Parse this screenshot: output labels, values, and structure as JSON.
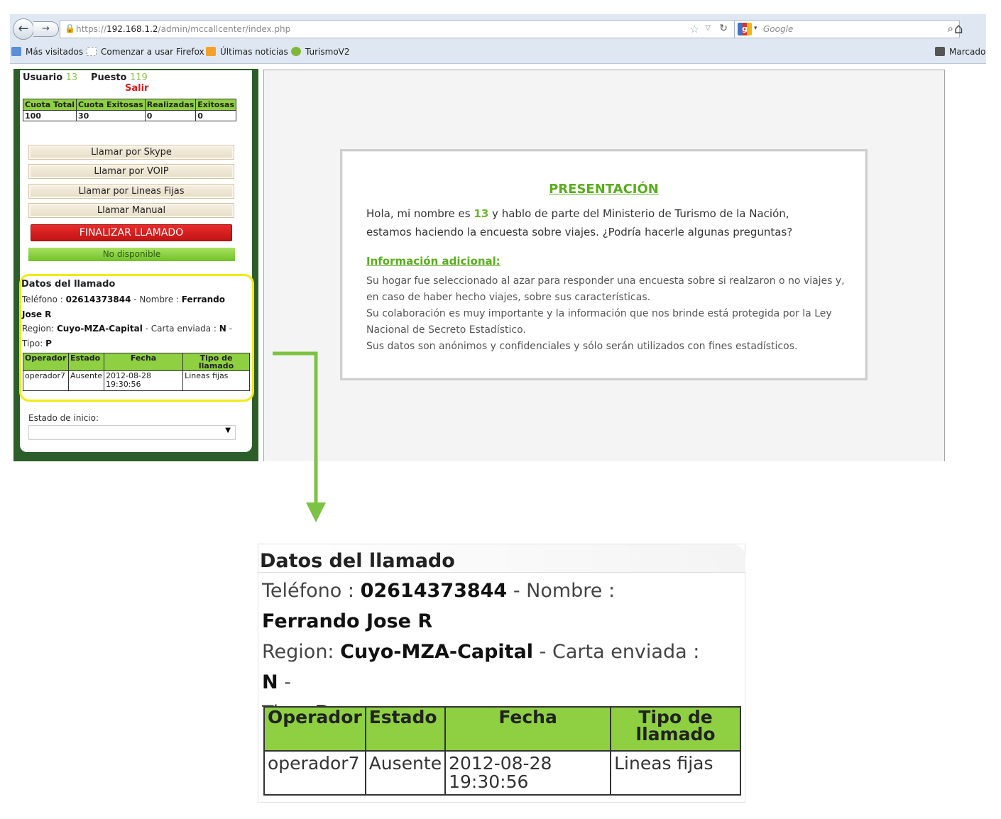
{
  "browser": {
    "url_prefix": "https://",
    "url_host": "192.168.1.2",
    "url_path": "/admin/mccallcenter/index.php",
    "search_placeholder": "Google",
    "bookmarks": [
      {
        "label": "Más visitados",
        "icon": "globe-icon"
      },
      {
        "label": "Comenzar a usar Firefox",
        "icon": "page-icon"
      },
      {
        "label": "Últimas noticias",
        "icon": "rss-icon"
      },
      {
        "label": "TurismoV2",
        "icon": "flag-icon"
      },
      {
        "label": "Marcado",
        "icon": "bookmarks-icon"
      }
    ]
  },
  "sidebar": {
    "usuario_label": "Usuario",
    "usuario_value": "13",
    "puesto_label": "Puesto",
    "puesto_value": "119",
    "salir": "Salir",
    "cuota_headers": [
      "Cuota Total",
      "Cuota Exitosas",
      "Realizadas",
      "Exitosas"
    ],
    "cuota_values": [
      "100",
      "30",
      "0",
      "0"
    ],
    "buttons": [
      "Llamar por Skype",
      "Llamar por VOIP",
      "Llamar por Lineas Fijas",
      "Llamar Manual"
    ],
    "finalizar": "FINALIZAR LLAMADO",
    "status": "No disponible",
    "estado_inicio_label": "Estado de inicio:",
    "estado_inicio_value": ""
  },
  "datos": {
    "title": "Datos del llamado",
    "telefono_label": "Teléfono :",
    "telefono": "02614373844",
    "nombre_label": "- Nombre :",
    "nombre": "Ferrando Jose R",
    "region_label": "Region:",
    "region": "Cuyo-MZA-Capital",
    "carta_label": "- Carta enviada :",
    "carta": "N",
    "tipo_sep": "-",
    "tipo_label": "Tipo:",
    "tipo": "P",
    "table_headers": [
      "Operador",
      "Estado",
      "Fecha",
      "Tipo de llamado"
    ],
    "table_row": {
      "operador": "operador7",
      "estado": "Ausente",
      "fecha_date": "2012-08-28",
      "fecha_time": "19:30:56",
      "tipo_llamado": "Lineas fijas"
    }
  },
  "presentacion": {
    "title": "PRESENTACIÓN",
    "text_before": "Hola, mi nombre es",
    "name": "13",
    "text_after": "y hablo de parte del Ministerio de Turismo de la Nación, estamos haciendo la encuesta sobre viajes. ¿Podría hacerle algunas preguntas?",
    "info_title": "Información adicional:",
    "info_lines": [
      "Su hogar fue seleccionado al azar para responder una encuesta sobre si realzaron o no viajes y, en caso de haber hecho viajes, sobre sus características.",
      "Su colaboración es muy importante y la información que nos brinde está protegida por la Ley Nacional de Secreto Estadístico.",
      "Sus datos son anónimos y confidenciales y sólo serán utilizados con fines estadísticos."
    ]
  },
  "colors": {
    "accent_green": "#8ed042",
    "sidebar_green": "#2c5e2a",
    "danger_red": "#d51e1e",
    "highlight_yellow": "#f2ea12",
    "arrow_green": "#7cc243"
  }
}
